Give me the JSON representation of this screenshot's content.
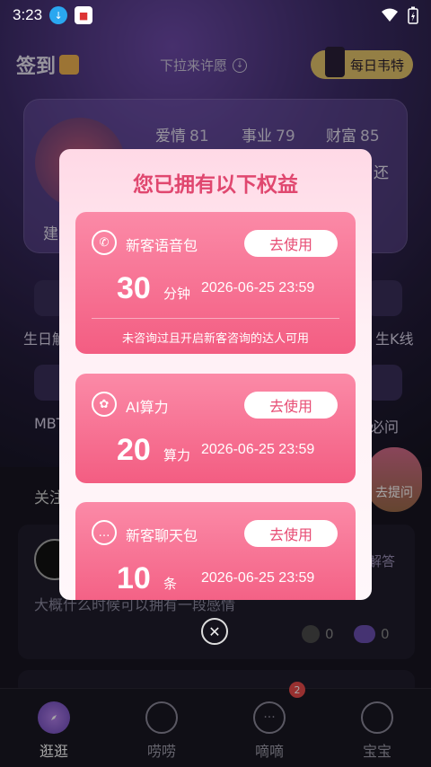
{
  "status_bar": {
    "time": "3:23"
  },
  "header": {
    "signin_label": "签到",
    "pulldown_label": "下拉来许愿",
    "daily_label": "每日韦特"
  },
  "fortune": {
    "stats": [
      {
        "label": "爱情",
        "value": "81"
      },
      {
        "label": "事业",
        "value": "79"
      },
      {
        "label": "财富",
        "value": "85"
      }
    ],
    "frag_left": "建",
    "frag_right": "还"
  },
  "grid_fragments": {
    "birthday": "生日解",
    "kline": "生K线",
    "mbti": "MBT",
    "ask": "必问",
    "ask_button": "去提问"
  },
  "feed": {
    "follow_label": "关注",
    "answer_label": "解答",
    "question": "大概什么时候可以拥有一段感情",
    "likes": "0",
    "comments": "0"
  },
  "modal": {
    "title": "您已拥有以下权益",
    "benefits": [
      {
        "name": "新客语音包",
        "button": "去使用",
        "amount": "30",
        "unit": "分钟",
        "date": "2026-06-25 23:59",
        "note": "未咨询过且开启新客咨询的达人可用"
      },
      {
        "name": "AI算力",
        "button": "去使用",
        "amount": "20",
        "unit": "算力",
        "date": "2026-06-25 23:59"
      },
      {
        "name": "新客聊天包",
        "button": "去使用",
        "amount": "10",
        "unit": "条",
        "date": "2026-06-25 23:59"
      }
    ]
  },
  "bottom_nav": {
    "items": [
      {
        "label": "逛逛"
      },
      {
        "label": "唠唠"
      },
      {
        "label": "嘀嘀"
      },
      {
        "label": "宝宝"
      }
    ],
    "badge": "2"
  },
  "colors": {
    "accent": "#e0476f",
    "card_pink": "#f35d82",
    "nav_bg": "#1a1822"
  }
}
